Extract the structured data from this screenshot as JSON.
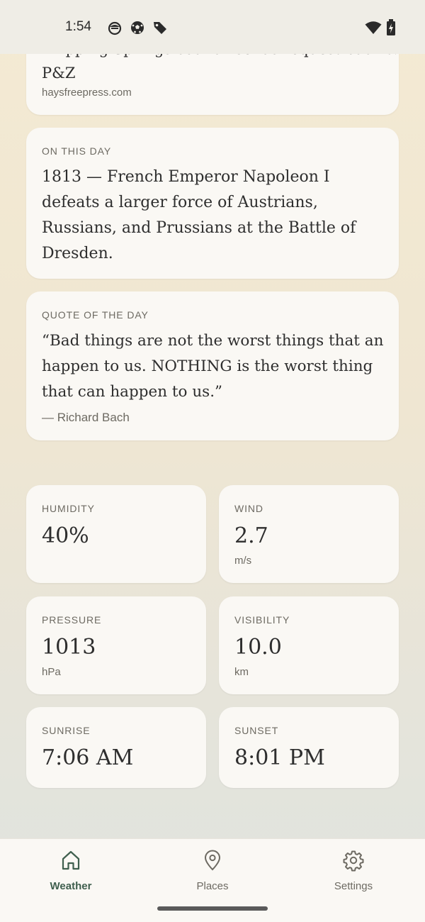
{
  "status_bar": {
    "time": "1:54",
    "notification_icons": [
      "cat-face-icon",
      "soccer-ball-icon",
      "tag-icon"
    ],
    "system_icons": [
      "wifi-icon",
      "battery-charging-icon"
    ]
  },
  "news_card": {
    "headline_partial": "Dripping Springs council sends request back to",
    "headline_end": "P&Z",
    "source": "haysfreepress.com"
  },
  "on_this_day": {
    "label": "ON THIS DAY",
    "text": "1813 — French Emperor Napoleon I defeats a larger force of Austrians, Russians, and Prussians at the Battle of Dresden."
  },
  "quote_of_day": {
    "label": "QUOTE OF THE DAY",
    "text": "“Bad things are not the worst things that an happen to us. NOTHING is the worst thing that can happen to us.”",
    "author": "— Richard Bach"
  },
  "metrics": {
    "humidity": {
      "label": "HUMIDITY",
      "value": "40%"
    },
    "wind": {
      "label": "WIND",
      "value": "2.7",
      "unit": "m/s"
    },
    "pressure": {
      "label": "PRESSURE",
      "value": "1013",
      "unit": "hPa"
    },
    "visibility": {
      "label": "VISIBILITY",
      "value": "10.0",
      "unit": "km"
    },
    "sunrise": {
      "label": "SUNRISE",
      "value": "7:06 AM"
    },
    "sunset": {
      "label": "SUNSET",
      "value": "8:01 PM"
    }
  },
  "nav": {
    "items": [
      {
        "label": "Weather",
        "icon": "home-icon",
        "active": true
      },
      {
        "label": "Places",
        "icon": "location-pin-icon",
        "active": false
      },
      {
        "label": "Settings",
        "icon": "gear-icon",
        "active": false
      }
    ]
  },
  "colors": {
    "accent": "#3f5f4e",
    "card_background": "#faf8f4",
    "muted_text": "#6d6a62"
  }
}
